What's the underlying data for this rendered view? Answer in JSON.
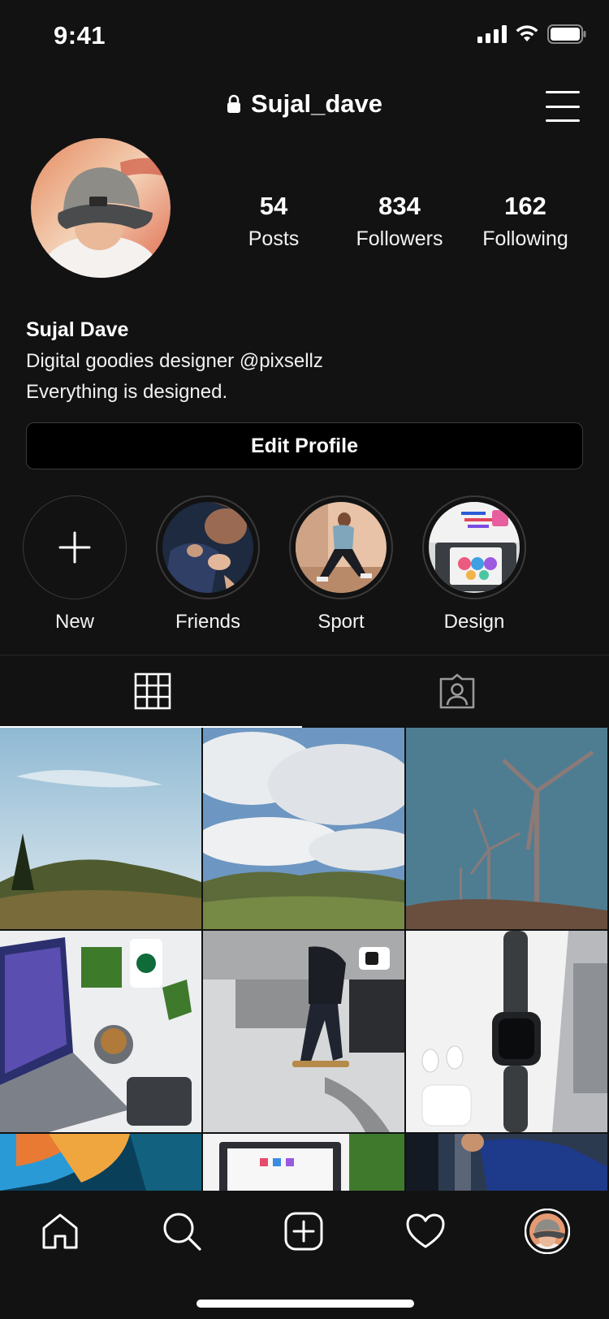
{
  "status_bar": {
    "time": "9:41"
  },
  "header": {
    "username": "Sujal_dave"
  },
  "profile": {
    "stats": [
      {
        "count": "54",
        "label": "Posts"
      },
      {
        "count": "834",
        "label": "Followers"
      },
      {
        "count": "162",
        "label": "Following"
      }
    ],
    "name": "Sujal Dave",
    "bio_lines": [
      "Digital goodies designer @pixsellz",
      "Everything is designed."
    ],
    "edit_button_label": "Edit Profile"
  },
  "highlights": [
    {
      "label": "New"
    },
    {
      "label": "Friends"
    },
    {
      "label": "Sport"
    },
    {
      "label": "Design"
    }
  ],
  "tabs": [
    {
      "icon": "grid-icon",
      "active": true
    },
    {
      "icon": "tagged-icon",
      "active": false
    }
  ],
  "bottom_nav": [
    {
      "icon": "home-icon"
    },
    {
      "icon": "search-icon"
    },
    {
      "icon": "add-post-icon"
    },
    {
      "icon": "heart-icon"
    },
    {
      "icon": "profile-avatar"
    }
  ]
}
